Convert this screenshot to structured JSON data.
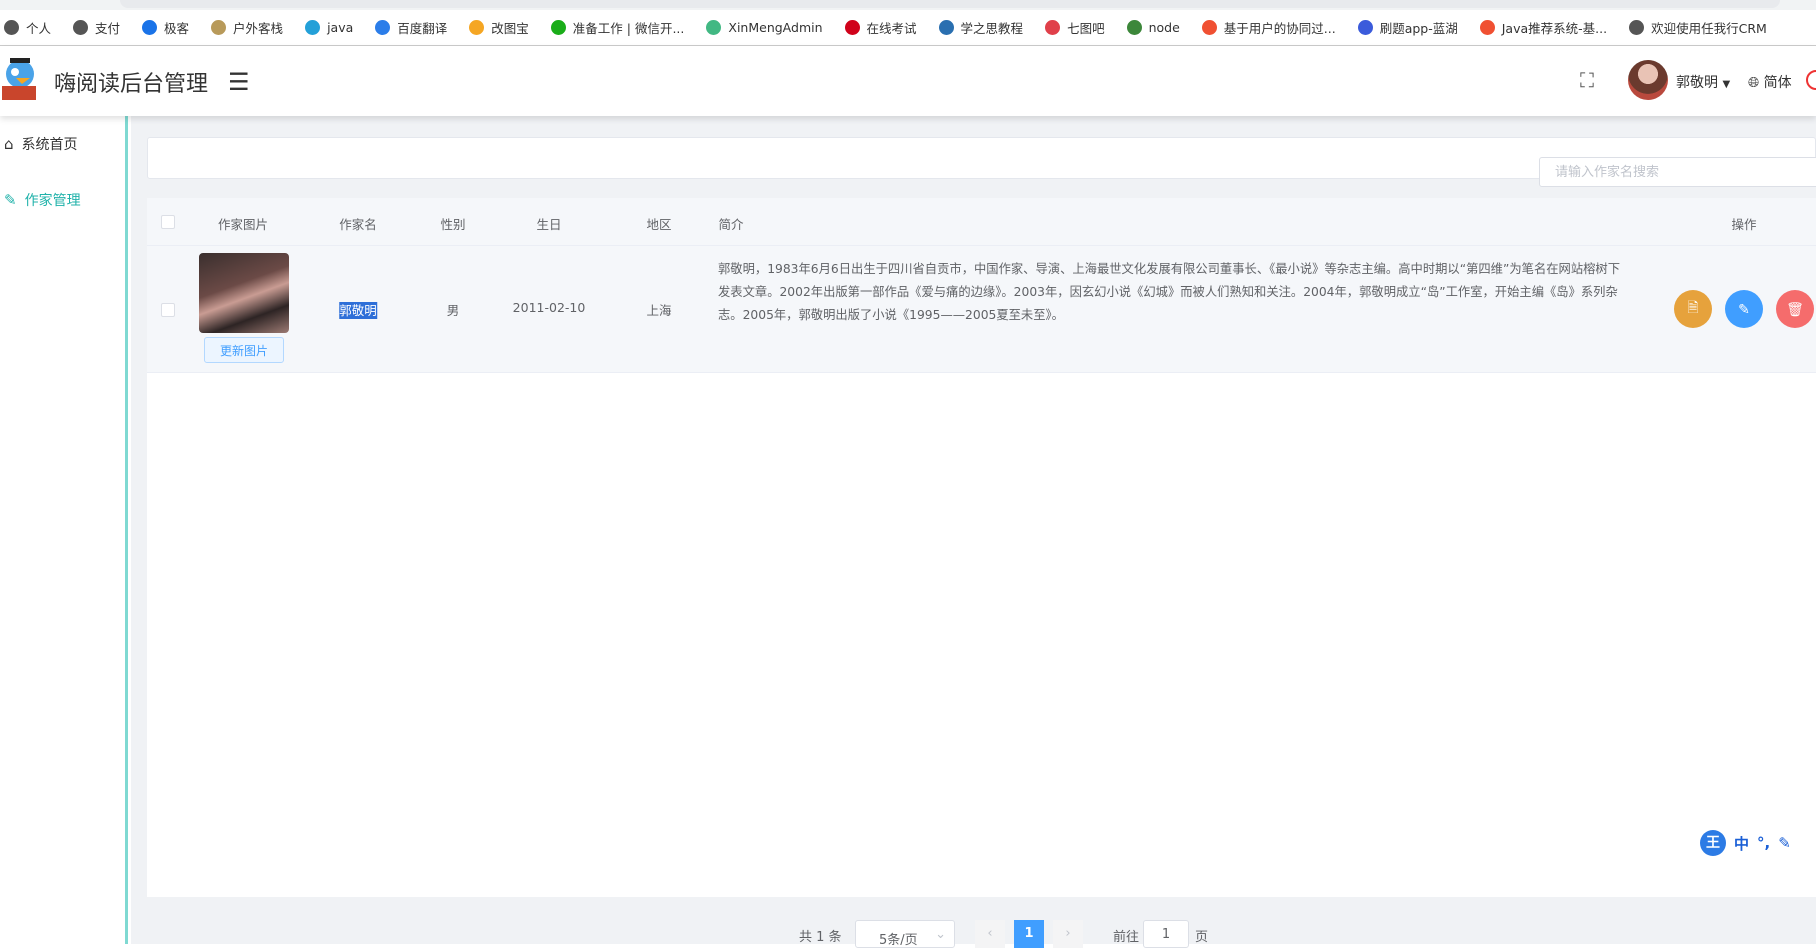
{
  "browser": {
    "bookmarks": [
      {
        "label": "个人",
        "color": "#555"
      },
      {
        "label": "支付",
        "color": "#555"
      },
      {
        "label": "极客",
        "color": "#1a73e8"
      },
      {
        "label": "户外客栈",
        "color": "#b89a5a"
      },
      {
        "label": "java",
        "color": "#23a0d8"
      },
      {
        "label": "百度翻译",
        "color": "#2b7de9"
      },
      {
        "label": "改图宝",
        "color": "#f5a623"
      },
      {
        "label": "准备工作 | 微信开...",
        "color": "#1aad19"
      },
      {
        "label": "XinMengAdmin",
        "color": "#41b883"
      },
      {
        "label": "在线考试",
        "color": "#d0021b"
      },
      {
        "label": "学之思教程",
        "color": "#2a6fb0"
      },
      {
        "label": "七图吧",
        "color": "#e0404a"
      },
      {
        "label": "node",
        "color": "#3c873a"
      },
      {
        "label": "基于用户的协同过...",
        "color": "#f05032"
      },
      {
        "label": "刷题app-蓝湖",
        "color": "#3b5bdb"
      },
      {
        "label": "Java推荐系统-基...",
        "color": "#f05032"
      },
      {
        "label": "欢迎使用任我行CRM",
        "color": "#555"
      }
    ]
  },
  "header": {
    "title": "嗨阅读后台管理",
    "menu_icon": "hamburger-icon",
    "fullscreen_icon": "fullscreen-icon",
    "username": "郭敬明",
    "language": "简体"
  },
  "sidebar": {
    "items": [
      {
        "label": "系统首页",
        "icon": "home-icon",
        "active": false
      },
      {
        "label": "作家管理",
        "icon": "edit-icon",
        "active": true
      }
    ],
    "accent": "#20b2aa"
  },
  "search": {
    "placeholder": "请输入作家名搜索",
    "value": ""
  },
  "table": {
    "columns": [
      "作家图片",
      "作家名",
      "性别",
      "生日",
      "地区",
      "简介",
      "操作"
    ],
    "rows": [
      {
        "name": "郭敬明",
        "gender": "男",
        "birthday": "2011-02-10",
        "region": "上海",
        "update_photo": "更新图片",
        "bio": "郭敬明，1983年6月6日出生于四川省自贡市，中国作家、导演、上海最世文化发展有限公司董事长、《最小说》等杂志主编。高中时期以“第四维”为笔名在网站榕树下发表文章。2002年出版第一部作品《爱与痛的边缘》。2003年，因玄幻小说《幻城》而被人们熟知和关注。2004年，郭敬明成立“岛”工作室，开始主编《岛》系列杂志。2005年，郭敬明出版了小说《1995——2005夏至未至》。"
      }
    ],
    "actions": [
      {
        "icon": "document-icon",
        "color": "#e6a23c"
      },
      {
        "icon": "edit-icon",
        "color": "#409eff"
      },
      {
        "icon": "delete-icon",
        "color": "#f56c6c"
      }
    ]
  },
  "pagination": {
    "total": "共 1 条",
    "page_size": "5条/页",
    "current": "1",
    "goto_label": "前往",
    "goto_value": "1",
    "page_suffix": "页",
    "active_color": "#409eff"
  },
  "ime": {
    "label": "中"
  }
}
